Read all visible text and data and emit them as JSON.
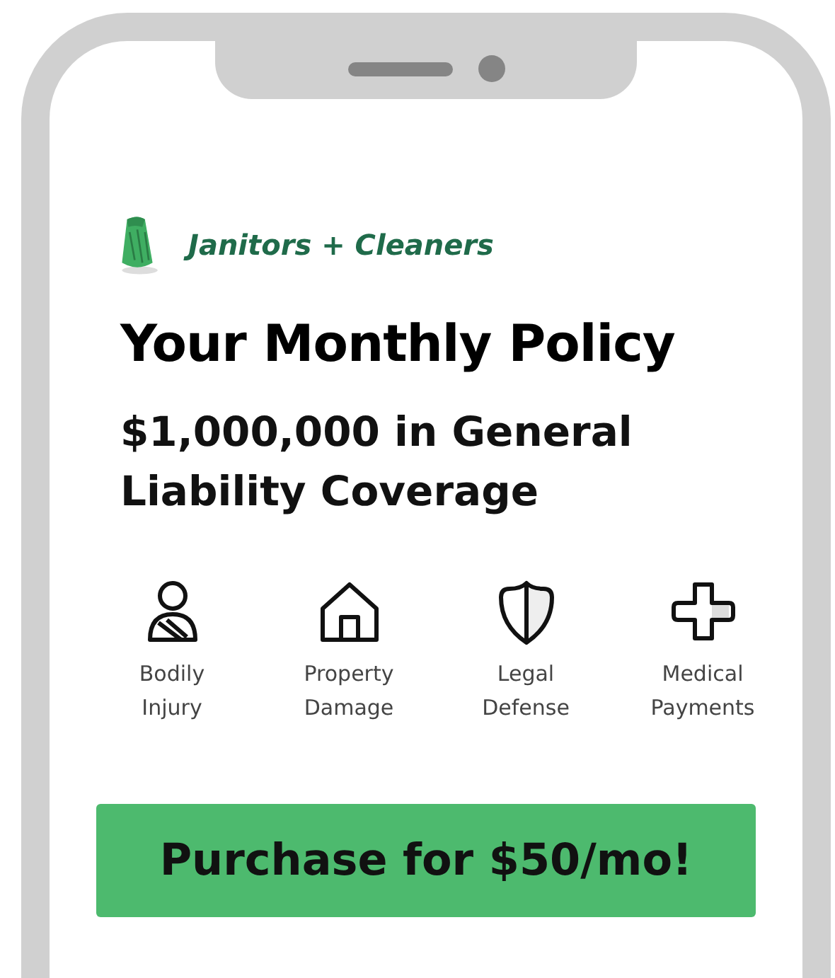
{
  "brand": {
    "label": "Janitors + Cleaners"
  },
  "title": "Your Monthly Policy",
  "subtitle": "$1,000,000 in General Liability Coverage",
  "coverages": [
    {
      "kind": "person",
      "label": "Bodily Injury"
    },
    {
      "kind": "house",
      "label": "Property Damage"
    },
    {
      "kind": "shield",
      "label": "Legal Defense"
    },
    {
      "kind": "cross",
      "label": "Medical Payments"
    }
  ],
  "button": "Purchase for $50/mo!"
}
